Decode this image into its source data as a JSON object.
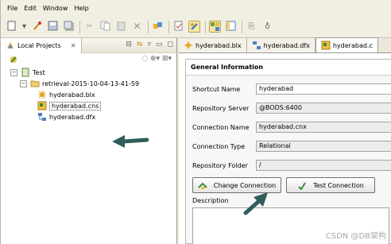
{
  "menubar": {
    "items": [
      "File",
      "Edit",
      "Window",
      "Help"
    ]
  },
  "toolbar": {
    "icons": [
      "new-icon",
      "dropdown-icon",
      "wrench-icon",
      "save-icon",
      "save-all-icon",
      "cut-icon",
      "copy-icon",
      "paste-icon",
      "delete-icon",
      "import-icon",
      "validate-icon",
      "debug-icon",
      "tiles-icon",
      "layout-icon",
      "search-icon",
      "binoculars-icon"
    ]
  },
  "left_panel": {
    "tab_label": "Local Projects",
    "tree": {
      "root": "Test",
      "folder": "retrieval-2015-10-04-13-41-59",
      "files": [
        "hyderabad.blx",
        "hyderabad.cns",
        "hyderabad.dfx"
      ],
      "selected_index": 1
    }
  },
  "editor": {
    "tabs": [
      "hyderabad.blx",
      "hyderabad.dfx",
      "hyderabad.c"
    ],
    "active_tab": 2,
    "section_title": "General Information",
    "fields": [
      {
        "label": "Shortcut Name",
        "value": "hyderabad"
      },
      {
        "label": "Repository Server",
        "value": "@BODS:6400"
      },
      {
        "label": "Connection Name",
        "value": "hyderabad.cnx"
      },
      {
        "label": "Connection Type",
        "value": "Relational"
      },
      {
        "label": "Repository Folder",
        "value": "/"
      }
    ],
    "buttons": {
      "change_connection": "Change Connection",
      "test_connection": "Test Connection"
    },
    "description_label": "Description"
  },
  "watermark": "CSDN @DB架构"
}
